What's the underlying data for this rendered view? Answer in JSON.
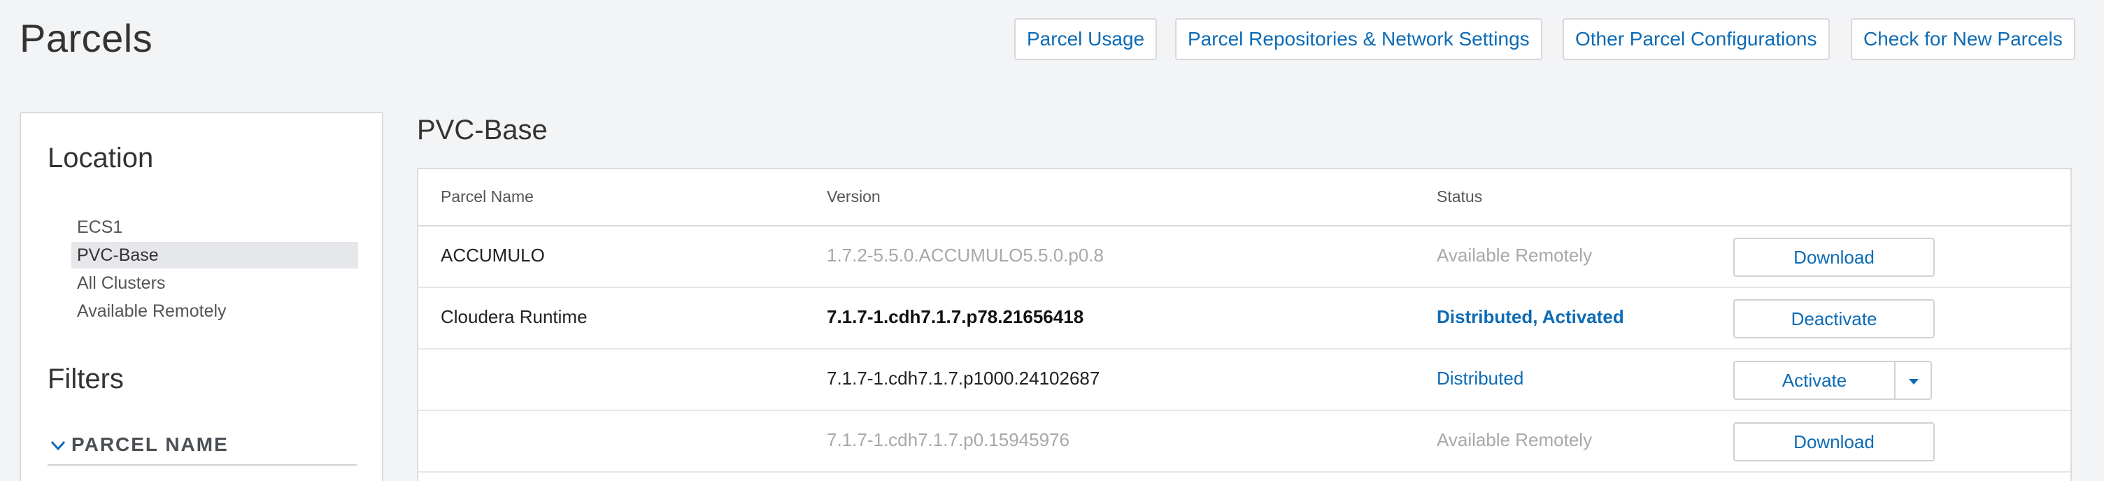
{
  "page": {
    "title": "Parcels"
  },
  "toolbar": {
    "parcel_usage": "Parcel Usage",
    "repos_network": "Parcel Repositories & Network Settings",
    "other_configs": "Other Parcel Configurations",
    "check_new": "Check for New Parcels"
  },
  "sidebar": {
    "location_heading": "Location",
    "locations": [
      {
        "label": "ECS1",
        "active": false
      },
      {
        "label": "PVC-Base",
        "active": true
      },
      {
        "label": "All Clusters",
        "active": false
      },
      {
        "label": "Available Remotely",
        "active": false
      }
    ],
    "filters_heading": "Filters",
    "filter_parcel_name": "PARCEL NAME"
  },
  "main": {
    "section_title": "PVC-Base",
    "columns": {
      "name": "Parcel Name",
      "version": "Version",
      "status": "Status"
    },
    "rows": [
      {
        "name": "ACCUMULO",
        "version": "1.7.2-5.5.0.ACCUMULO5.5.0.p0.8",
        "status": "Available Remotely",
        "action": "Download"
      },
      {
        "name": "Cloudera Runtime",
        "version": "7.1.7-1.cdh7.1.7.p78.21656418",
        "status": "Distributed, Activated",
        "action": "Deactivate"
      },
      {
        "name": "",
        "version": "7.1.7-1.cdh7.1.7.p1000.24102687",
        "status": "Distributed",
        "action": "Activate"
      },
      {
        "name": "",
        "version": "7.1.7-1.cdh7.1.7.p0.15945976",
        "status": "Available Remotely",
        "action": "Download"
      }
    ]
  },
  "icons": {
    "chevron": "chevron-down-icon",
    "caret": "caret-down-icon"
  },
  "colors": {
    "accent": "#0d6bb5",
    "muted": "#a6a8ac"
  }
}
